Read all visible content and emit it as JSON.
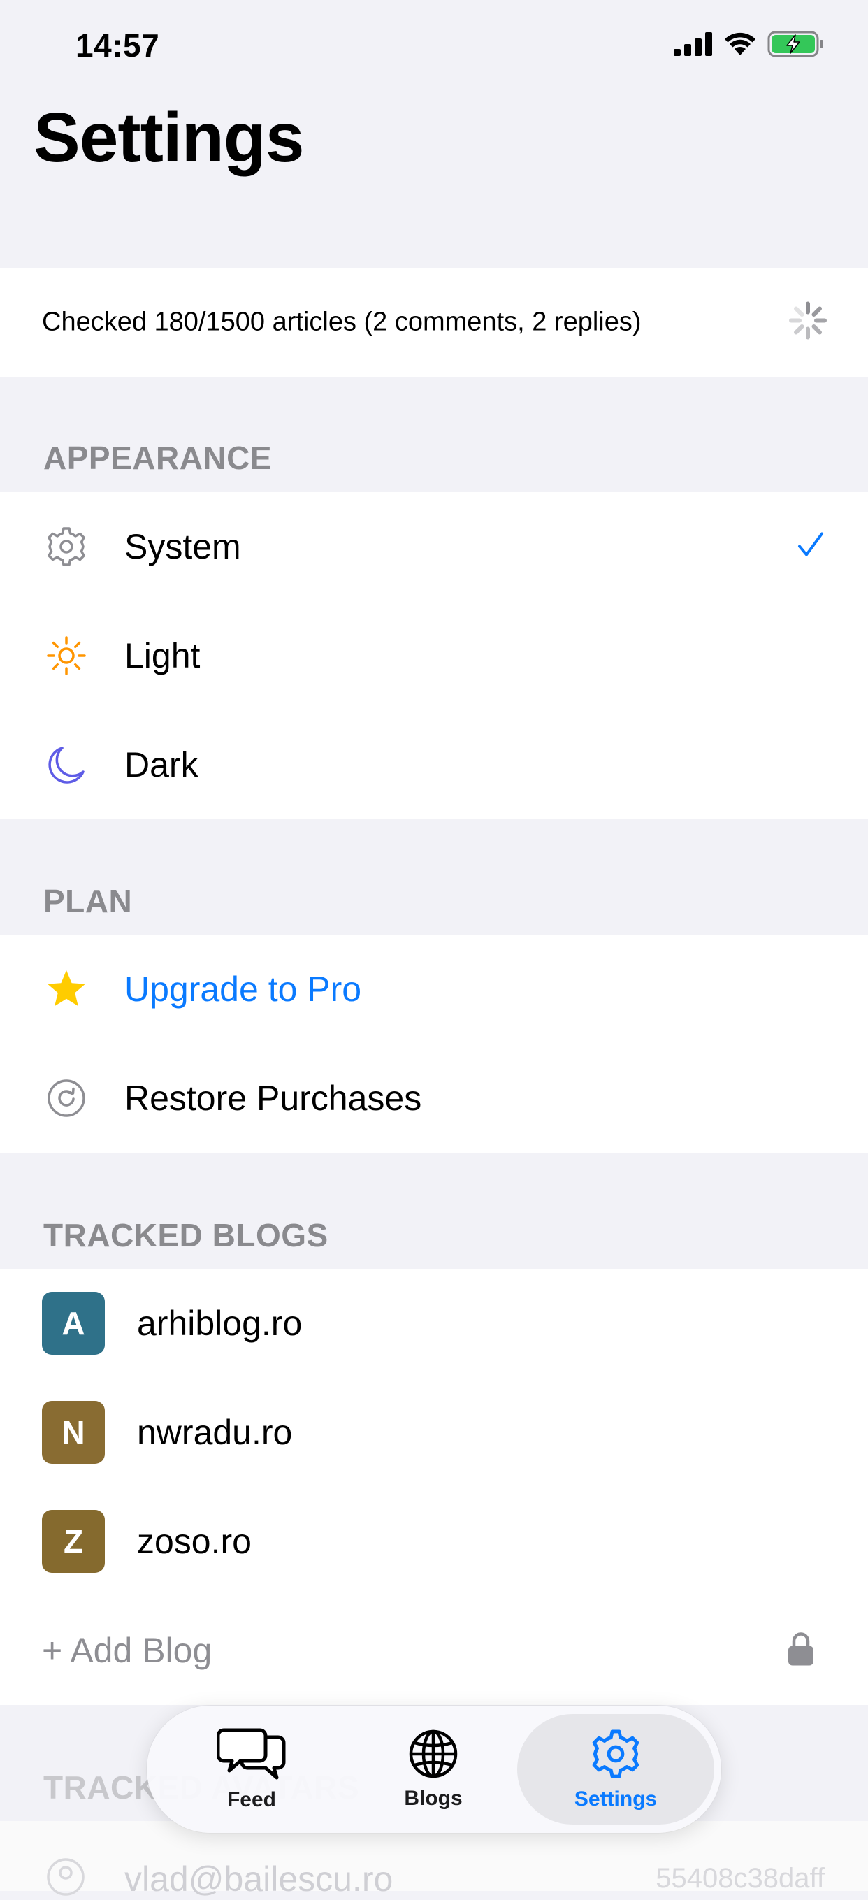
{
  "status_bar": {
    "time": "14:57"
  },
  "page": {
    "title": "Settings"
  },
  "progress": {
    "text": "Checked 180/1500 articles (2 comments, 2 replies)"
  },
  "appearance": {
    "header": "APPEARANCE",
    "items": [
      {
        "label": "System",
        "icon": "gear-icon",
        "selected": true
      },
      {
        "label": "Light",
        "icon": "sun-icon",
        "selected": false
      },
      {
        "label": "Dark",
        "icon": "moon-icon",
        "selected": false
      }
    ]
  },
  "plan": {
    "header": "PLAN",
    "upgrade_label": "Upgrade to Pro",
    "restore_label": "Restore Purchases"
  },
  "tracked_blogs": {
    "header": "TRACKED BLOGS",
    "items": [
      {
        "letter": "A",
        "name": "arhiblog.ro",
        "color": "#2f7189"
      },
      {
        "letter": "N",
        "name": "nwradu.ro",
        "color": "#896c32"
      },
      {
        "letter": "Z",
        "name": "zoso.ro",
        "color": "#856a2e"
      }
    ],
    "add_label": "+ Add Blog"
  },
  "tracked_avatars": {
    "header": "TRACKED AVATARS",
    "items": [
      {
        "email": "vlad@bailescu.ro",
        "id": "55408c38daff"
      }
    ]
  },
  "tab_bar": {
    "feed": "Feed",
    "blogs": "Blogs",
    "settings": "Settings"
  },
  "colors": {
    "accent": "#0a7aff",
    "background": "#f2f2f7",
    "secondary_text": "#8a8a8e",
    "star": "#ffcc00",
    "sun": "#ff9500",
    "moon": "#5e5ce6",
    "battery": "#34c759"
  }
}
